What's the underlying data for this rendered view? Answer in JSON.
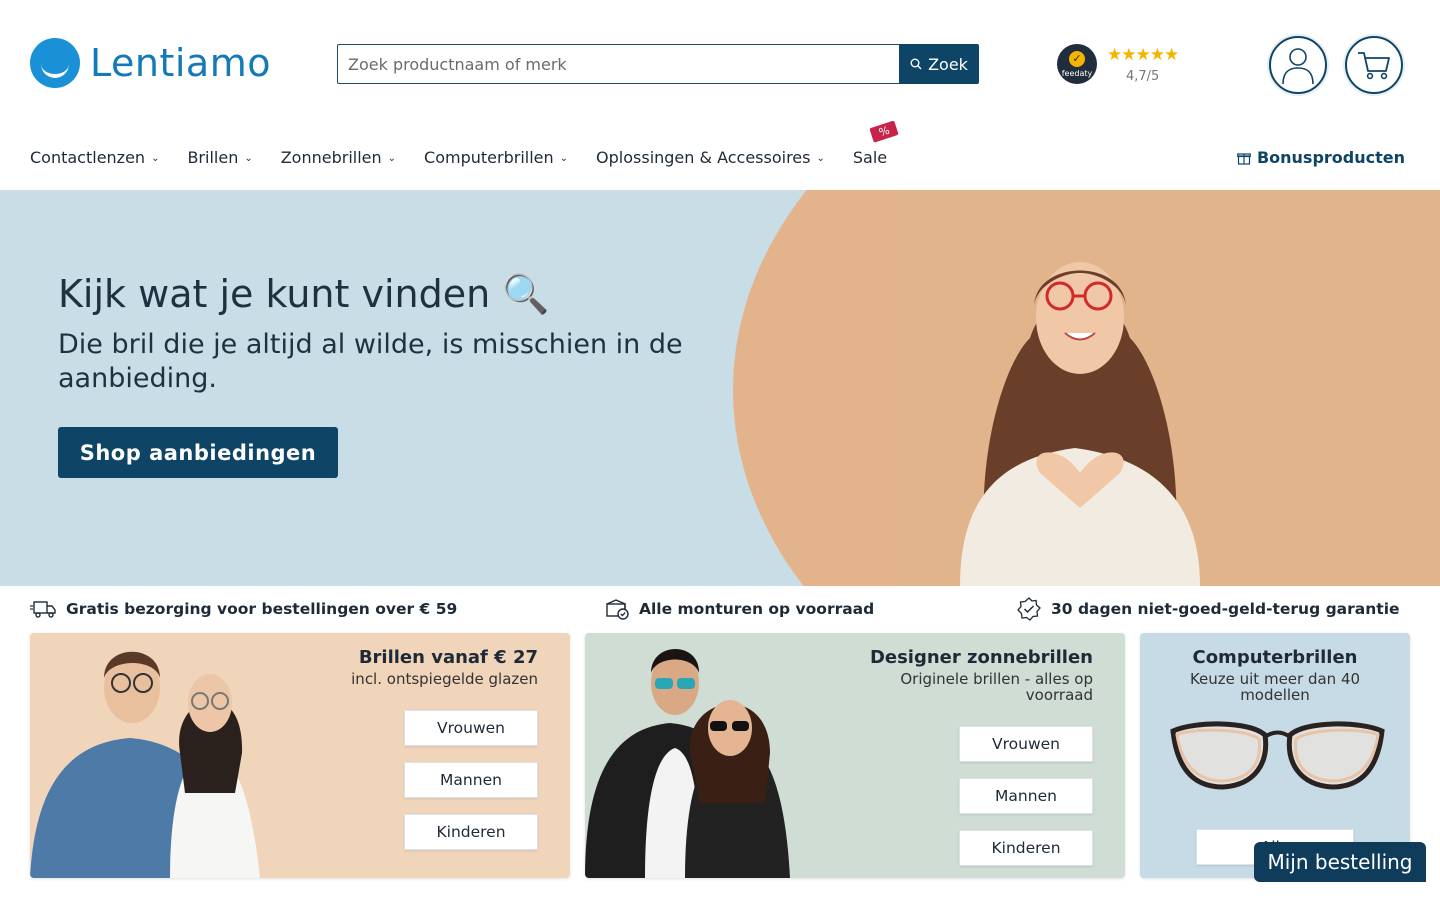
{
  "brand": {
    "name": "Lentiamo"
  },
  "search": {
    "placeholder": "Zoek productnaam of merk",
    "button_label": "Zoek"
  },
  "rating": {
    "badge_text": "feedaty",
    "stars": "★★★★★",
    "score": "4,7/5"
  },
  "nav": {
    "items": [
      {
        "label": "Contactlenzen"
      },
      {
        "label": "Brillen"
      },
      {
        "label": "Zonnebrillen"
      },
      {
        "label": "Computerbrillen"
      },
      {
        "label": "Oplossingen & Accessoires"
      },
      {
        "label": "Sale"
      }
    ],
    "sale_badge": "%",
    "bonus_label": "Bonusproducten"
  },
  "hero": {
    "title": "Kijk wat je kunt vinden 🔍",
    "subtitle": "Die bril die je altijd al wilde, is misschien in de aanbieding.",
    "cta": "Shop aanbiedingen"
  },
  "usps": [
    {
      "text": "Gratis bezorging voor bestellingen over € 59"
    },
    {
      "text": "Alle monturen op voorraad"
    },
    {
      "text": "30 dagen niet-goed-geld-terug garantie"
    }
  ],
  "cards": [
    {
      "title": "Brillen vanaf € 27",
      "subtitle": "incl. ontspiegelde glazen",
      "buttons": [
        "Vrouwen",
        "Mannen",
        "Kinderen"
      ]
    },
    {
      "title": "Designer zonnebrillen",
      "subtitle": "Originele brillen - alles op voorraad",
      "buttons": [
        "Vrouwen",
        "Mannen",
        "Kinderen"
      ]
    },
    {
      "title": "Computerbrillen",
      "subtitle": "Keuze uit meer dan 40 modellen",
      "buttons": [
        "Alle"
      ]
    }
  ],
  "order_button": "Mijn bestelling",
  "colors": {
    "primary": "#0e4466",
    "brand_blue": "#1a91d6",
    "hero_bg": "#c8dde6",
    "hero_peach": "#e3b48c",
    "sale_red": "#c8234a",
    "star": "#f5b400"
  }
}
